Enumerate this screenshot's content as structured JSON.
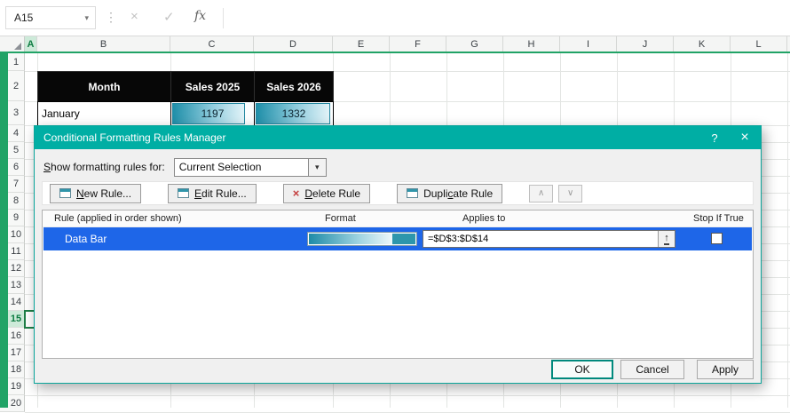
{
  "formula_bar": {
    "name_box": "A15",
    "fx_label": "fx"
  },
  "grid": {
    "columns": [
      "A",
      "B",
      "C",
      "D",
      "E",
      "F",
      "G",
      "H",
      "I",
      "J",
      "K",
      "L"
    ],
    "rows": [
      1,
      2,
      3,
      4,
      5,
      6,
      7,
      8,
      9,
      10,
      11,
      12,
      13,
      14,
      15,
      16,
      17,
      18,
      19,
      20
    ],
    "selected_column": "A",
    "selected_row": 15,
    "selection_ref": "A15",
    "cells": [
      {
        "ref": "B2",
        "kind": "header",
        "text": "Month"
      },
      {
        "ref": "C2",
        "kind": "header",
        "text": "Sales 2025"
      },
      {
        "ref": "D2",
        "kind": "header",
        "text": "Sales 2026"
      },
      {
        "ref": "B3",
        "kind": "label",
        "text": "January"
      },
      {
        "ref": "C3",
        "kind": "databar",
        "text": "1197",
        "pct": 88
      },
      {
        "ref": "D3",
        "kind": "databar",
        "text": "1332",
        "pct": 96
      }
    ]
  },
  "dialog": {
    "title": "Conditional Formatting Rules Manager",
    "help_label": "?",
    "close_label": "×",
    "scope_label": {
      "key": "S",
      "post": "how formatting rules for:"
    },
    "scope_value": "Current Selection",
    "buttons": {
      "new_rule": {
        "pre": "",
        "key": "N",
        "post": "ew Rule..."
      },
      "edit_rule": {
        "pre": "",
        "key": "E",
        "post": "dit Rule..."
      },
      "delete_rule": {
        "pre": "",
        "key": "D",
        "post": "elete Rule"
      },
      "duplicate_rule": {
        "pre": "Dupli",
        "key": "c",
        "post": "ate Rule"
      },
      "move_up_icon": "∧",
      "move_down_icon": "∨"
    },
    "list": {
      "headers": [
        "Rule (applied in order shown)",
        "Format",
        "Applies to",
        "Stop If True"
      ],
      "rules": [
        {
          "name": "Data Bar",
          "applies_to": "=$D$3:$D$14",
          "stop_if_true": false
        }
      ]
    },
    "footer": {
      "ok": "OK",
      "cancel": "Cancel",
      "apply": "Apply"
    }
  }
}
